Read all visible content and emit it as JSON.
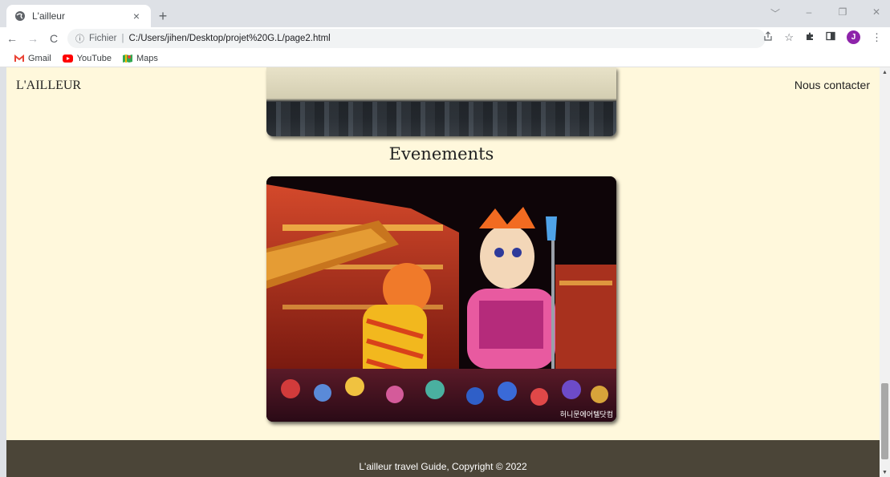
{
  "browser": {
    "tab_title": "L'ailleur",
    "tab_close": "×",
    "new_tab": "+",
    "window_controls": [
      "﹀",
      "–",
      "❐",
      "✕"
    ],
    "nav": {
      "back": "←",
      "forward": "→",
      "reload": "C"
    },
    "address": {
      "info_icon": "ⓘ",
      "scheme_label": "Fichier",
      "separator": "|",
      "url": "C:/Users/jihen/Desktop/projet%20G.L/page2.html"
    },
    "toolbar_icons": [
      "share-icon",
      "star-icon",
      "extensions-icon",
      "sidepanel-icon",
      "profile-avatar",
      "menu-icon"
    ],
    "profile_initial": "J",
    "bookmarks": [
      {
        "label": "Gmail",
        "icon": "gmail-icon",
        "color": "#ea4335"
      },
      {
        "label": "YouTube",
        "icon": "youtube-icon",
        "color": "#ff0000"
      },
      {
        "label": "Maps",
        "icon": "maps-icon",
        "color": "#34a853"
      }
    ]
  },
  "site": {
    "logo": "L'AILLEUR",
    "contact": "Nous contacter",
    "section_title": "Evenements",
    "photo_watermark": "허니문에어텔닷컴",
    "footer_text": "L'ailleur travel Guide, Copyright © 2022"
  },
  "colors": {
    "page_background": "#fff8dc",
    "footer_background": "#4b4538",
    "profile_color": "#8e24aa"
  }
}
